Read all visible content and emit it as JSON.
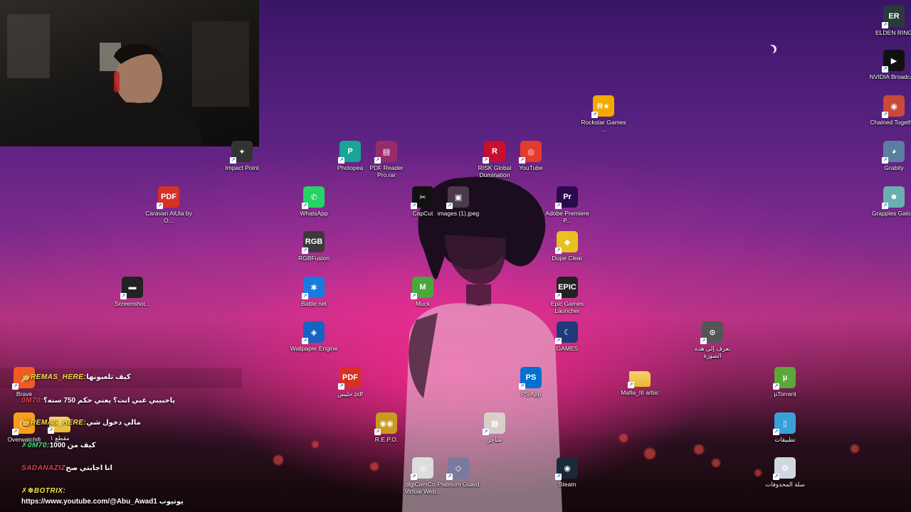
{
  "icons": [
    {
      "id": "elden-ring",
      "label": "ELDEN RING",
      "glyph": "ER",
      "color": "#2b3a3a"
    },
    {
      "id": "nvidia-broadcast",
      "label": "NVIDIA Broadcast",
      "glyph": "▶",
      "color": "#111"
    },
    {
      "id": "chained-together",
      "label": "Chained Together",
      "glyph": "◉",
      "color": "#c84a3a"
    },
    {
      "id": "grabity",
      "label": "Grabity",
      "glyph": "◕",
      "color": "#5b7fa0"
    },
    {
      "id": "grapples-galore",
      "label": "Grapples Galore",
      "glyph": "☻",
      "color": "#6ab0b0"
    },
    {
      "id": "rockstar",
      "label": "Rockstar Games ...",
      "glyph": "R★",
      "color": "#f2a900"
    },
    {
      "id": "impact-point",
      "label": "Impact Point",
      "glyph": "✦",
      "color": "#333"
    },
    {
      "id": "photopea",
      "label": "Photopea",
      "glyph": "P",
      "color": "#18a497"
    },
    {
      "id": "pdf-reader",
      "label": "PDF Reader Pro.rar",
      "glyph": "▤",
      "color": "#9a2b6a"
    },
    {
      "id": "risk",
      "label": "RISK Global Domination",
      "glyph": "R",
      "color": "#c8102e"
    },
    {
      "id": "youtube",
      "label": "YouTube",
      "glyph": "◎",
      "color": "#e33b2e"
    },
    {
      "id": "caravan",
      "label": "Caravan AlUla by O...",
      "glyph": "PDF",
      "color": "#d93025"
    },
    {
      "id": "whatsapp",
      "label": "WhatsApp",
      "glyph": "✆",
      "color": "#25d366"
    },
    {
      "id": "capcut",
      "label": "CapCut",
      "glyph": "✂",
      "color": "#111"
    },
    {
      "id": "images-jpeg",
      "label": "images (1).jpeg",
      "glyph": "▣",
      "color": "#4a3a4a"
    },
    {
      "id": "premiere",
      "label": "Adobe Premiere P...",
      "glyph": "Pr",
      "color": "#2a0a4a"
    },
    {
      "id": "rgbfusion",
      "label": "RGBFusion",
      "glyph": "RGB",
      "color": "#3a3a3a"
    },
    {
      "id": "dupe-clear",
      "label": "Dupe Clear",
      "glyph": "◆",
      "color": "#e8c020"
    },
    {
      "id": "screenshot",
      "label": "Screenshot...",
      "glyph": "▬",
      "color": "#222"
    },
    {
      "id": "battlenet",
      "label": "Battle.net",
      "glyph": "✱",
      "color": "#1a7ae0"
    },
    {
      "id": "muck",
      "label": "Muck",
      "glyph": "M",
      "color": "#4aa83a"
    },
    {
      "id": "epic",
      "label": "Epic Games Launcher",
      "glyph": "EPIC",
      "color": "#222"
    },
    {
      "id": "wallpaper-engine",
      "label": "Wallpaper Engine",
      "glyph": "◈",
      "color": "#1565c0"
    },
    {
      "id": "games",
      "label": "GAMES",
      "glyph": "☾",
      "color": "#1e3a7a"
    },
    {
      "id": "identify-image",
      "label": "تعرف إلى هذه الصورة",
      "glyph": "⊙",
      "color": "#555"
    },
    {
      "id": "brave",
      "label": "Brave",
      "glyph": "◭",
      "color": "#f25a24"
    },
    {
      "id": "halis-pdf",
      "label": "حليس.pdf",
      "glyph": "PDF",
      "color": "#d93025"
    },
    {
      "id": "ps-app",
      "label": "PS App",
      "glyph": "PS",
      "color": "#0070d1"
    },
    {
      "id": "mafia",
      "label": "Mafia_III arbic",
      "glyph": "",
      "color": "#e8b830"
    },
    {
      "id": "utorrent",
      "label": "µTorrent",
      "glyph": "µ",
      "color": "#5aa83a"
    },
    {
      "id": "overwatch",
      "label": "Overwatch®",
      "glyph": "◯",
      "color": "#f99e1a"
    },
    {
      "id": "clip1",
      "label": "مقطع ١",
      "glyph": "",
      "color": "#e8b830"
    },
    {
      "id": "repo",
      "label": "R.E.P.O.",
      "glyph": "◉◉",
      "color": "#c89a20"
    },
    {
      "id": "stores",
      "label": "متاجر",
      "glyph": "▦",
      "color": "#d8d0c8"
    },
    {
      "id": "apps",
      "label": "تطبيقات",
      "glyph": "▯",
      "color": "#3aa0d8"
    },
    {
      "id": "digicam",
      "label": "digiCamCo... Virtual Web...",
      "glyph": "◎",
      "color": "#ddd"
    },
    {
      "id": "platinum-guard",
      "label": "Platinum Guard",
      "glyph": "◇",
      "color": "#7a7aa0"
    },
    {
      "id": "steam",
      "label": "Steam",
      "glyph": "◉",
      "color": "#1b2838"
    },
    {
      "id": "recycle-bin",
      "label": "سلة المحذوفات",
      "glyph": "♻",
      "color": "#cfd8e0"
    }
  ],
  "chat": [
    {
      "user": "👑REMAS_HERE:",
      "message": "كيف تلعبونها",
      "user_color": "#f4e04a"
    },
    {
      "user": "0M70:",
      "message": "ياحبيبي غبي انت؟ يعني حكم 750 سنه؟",
      "user_color": "#e03a4a"
    },
    {
      "user": "👑REMAS_HERE:",
      "message": "مالي دخول شي",
      "user_color": "#f4e04a"
    },
    {
      "user": "✗0M70:",
      "message": "كيف من 1000",
      "user_color": "#3ae070"
    },
    {
      "user": "SADANAZIZ",
      "message": "انا اجابتي صح",
      "user_color": "#e03a4a"
    },
    {
      "user": "✗✽BOTRIX:",
      "message": "",
      "user_color": "#f4e04a"
    },
    {
      "user": "",
      "message": "https://www.youtube.com/@Abu_Awad1 يوتيوب",
      "user_color": "#ffffff"
    }
  ],
  "webcam": {
    "label": "webcam"
  }
}
